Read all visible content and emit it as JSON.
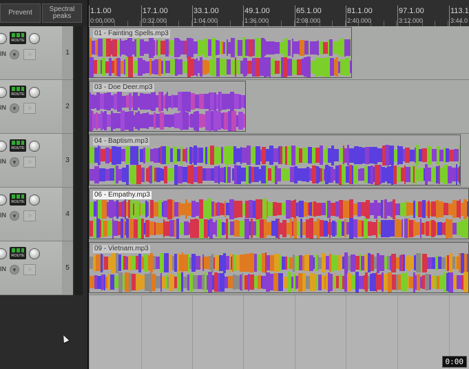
{
  "toolbar": {
    "prevent_label": "Prevent",
    "spectral_line1": "Spectral",
    "spectral_line2": "peaks"
  },
  "ruler": {
    "markers": [
      {
        "bar": "1.1.00",
        "time": "0:00.000"
      },
      {
        "bar": "17.1.00",
        "time": "0:32.000"
      },
      {
        "bar": "33.1.00",
        "time": "1:04.000"
      },
      {
        "bar": "49.1.00",
        "time": "1:36.000"
      },
      {
        "bar": "65.1.00",
        "time": "2:08.000"
      },
      {
        "bar": "81.1.00",
        "time": "2:40.000"
      },
      {
        "bar": "97.1.00",
        "time": "3:12.000"
      },
      {
        "bar": "113.1",
        "time": "3:44.0"
      }
    ]
  },
  "tracks": [
    {
      "number": "1",
      "in_label": "IN",
      "route_label": "ROUTE",
      "item": "01 - Fainting Spells.mp3"
    },
    {
      "number": "2",
      "in_label": "IN",
      "route_label": "ROUTE",
      "item": "03 - Doe Deer.mp3"
    },
    {
      "number": "3",
      "in_label": "IN",
      "route_label": "ROUTE",
      "item": "04 - Baptism.mp3"
    },
    {
      "number": "4",
      "in_label": "IN",
      "route_label": "ROUTE",
      "item": "06 - Empathy.mp3"
    },
    {
      "number": "5",
      "in_label": "IN",
      "route_label": "ROUTE",
      "item": "09 - Vietnam.mp3"
    }
  ],
  "time_display": "0:00",
  "colors": {
    "peak_purple": "#8a3fd0",
    "peak_green": "#7ccf2a",
    "peak_orange": "#e07a20",
    "peak_red": "#d8344a",
    "peak_blue": "#5a3ee0"
  },
  "icons": {
    "in_arrow": "triangle-down-icon",
    "fx": "arrow-right-icon",
    "folder": "folder-icon",
    "cursor": "mouse-pointer-icon"
  }
}
